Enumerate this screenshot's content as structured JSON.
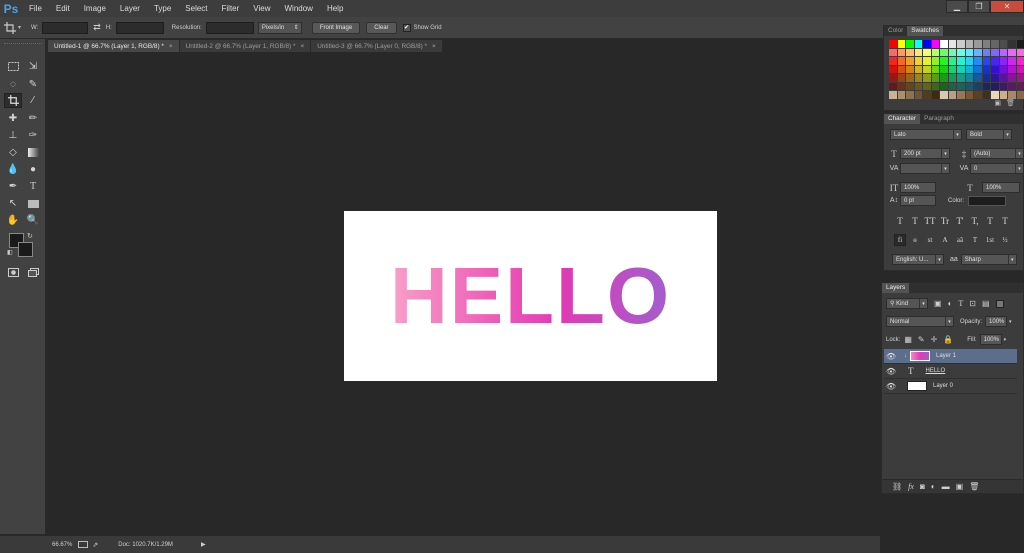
{
  "app": {
    "logo": "Ps"
  },
  "menu": [
    "File",
    "Edit",
    "Image",
    "Layer",
    "Type",
    "Select",
    "Filter",
    "View",
    "Window",
    "Help"
  ],
  "window_controls": {
    "minimize": "▁",
    "restore": "❐",
    "close": "✕"
  },
  "options": {
    "w_label": "W:",
    "h_label": "H:",
    "swap": "⇄",
    "resolution_label": "Resolution:",
    "units": "Pixels/in",
    "front_image": "Front Image",
    "clear": "Clear",
    "show_grid": "Show Grid",
    "show_grid_checked": true
  },
  "tabs": [
    {
      "label": "Untitled-1 @ 66.7% (Layer 1, RGB/8) *",
      "active": true,
      "close": "×"
    },
    {
      "label": "Untitled-2 @ 66.7% (Layer 1, RGB/8) *",
      "active": false,
      "close": "×"
    },
    {
      "label": "Untitled-3 @ 66.7% (Layer 0, RGB/8) *",
      "active": false,
      "close": "×"
    }
  ],
  "canvas": {
    "text": "HELLO",
    "gradient": [
      "#f8a0c8",
      "#ef5fb8",
      "#e13ab4",
      "#a05fcf"
    ]
  },
  "status": {
    "zoom": "66.67%",
    "doc": "Doc: 1020.7K/1.29M",
    "play": "▶"
  },
  "color_panel": {
    "tabs": [
      "Color",
      "Swatches"
    ],
    "active": "Swatches"
  },
  "character": {
    "tabs": [
      "Character",
      "Paragraph"
    ],
    "font": "Lato",
    "style": "Bold",
    "size": "200 pt",
    "leading": "(Auto)",
    "kerning": "",
    "tracking": "0",
    "vscale": "100%",
    "hscale": "100%",
    "baseline": "0 pt",
    "color_label": "Color:",
    "language": "English: U...",
    "antialias": "Sharp",
    "type_buttons": [
      "T",
      "T",
      "TT",
      "Tr",
      "T'",
      "T,",
      "T",
      "T"
    ],
    "ot_buttons": [
      "fi",
      "ɵ",
      "st",
      "A",
      "aā",
      "T",
      "1st",
      "½"
    ]
  },
  "layers": {
    "tab": "Layers",
    "filter": "Kind",
    "blend": "Normal",
    "opacity_label": "Opacity:",
    "opacity": "100%",
    "lock_label": "Lock:",
    "fill_label": "Fill:",
    "fill": "100%",
    "rows": [
      {
        "name": "Layer 1",
        "selected": true
      },
      {
        "name": "HELLO",
        "selected": false
      },
      {
        "name": "Layer 0",
        "selected": false
      }
    ]
  }
}
